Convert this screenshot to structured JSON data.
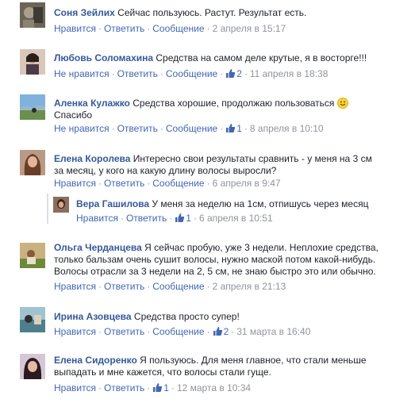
{
  "comments": [
    {
      "author": "Соня Зейлих",
      "text": "Сейчас пользуюсь. Растут. Результат есть.",
      "like_action": "Нравится",
      "reply_action": "Ответить",
      "message_action": "Сообщение",
      "likes": "",
      "time": "2 апреля в 15:17"
    },
    {
      "author": "Любовь Соломахина",
      "text": "Средства на самом деле крутые, я в восторге!!!",
      "like_action": "Не нравится",
      "reply_action": "Ответить",
      "message_action": "Сообщение",
      "likes": "2",
      "time": "11 апреля в 18:38"
    },
    {
      "author": "Аленка Кулажко",
      "text": "Средства хорошие, продолжаю пользоваться",
      "text_line2": "Спасибо",
      "emoji": "smile-emoji",
      "like_action": "Не нравится",
      "reply_action": "Ответить",
      "message_action": "Сообщение",
      "likes": "1",
      "time": "8 апреля в 10:10"
    },
    {
      "author": "Елена Королева",
      "text": "Интересно свои результаты сравнить - у меня на 3 см",
      "text_line2": "за месяц, у кого на какую длину волосы выросли?",
      "like_action": "Нравится",
      "reply_action": "Ответить",
      "message_action": "Сообщение",
      "likes": "",
      "time": "6 апреля в 9:47"
    },
    {
      "author": "Вера Гашилова",
      "text": "У меня за неделю на 1см, отпишусь через месяц",
      "like_action": "Нравится",
      "reply_action": "Ответить",
      "message_action": "",
      "likes": "1",
      "time": "6 апреля в 10:51"
    },
    {
      "author": "Ольга Черданцева",
      "text": "Я сейчас пробую, уже 3 недели. Неплохие средства,",
      "text_line2": "только бальзам очень сушит волосы, нужно маской потом какой-нибудь.",
      "text_line3": "Волосы отрасли за 3 недели на 2, 5 см, не знаю быстро это или обычно.",
      "like_action": "Нравится",
      "reply_action": "Ответить",
      "message_action": "Сообщение",
      "likes": "",
      "time": "2 апреля в 21:13"
    },
    {
      "author": "Ирина Азовцева",
      "text": "Средства просто супер!",
      "like_action": "Нравится",
      "reply_action": "Ответить",
      "message_action": "Сообщение",
      "likes": "2",
      "time": "31 марта в 16:40"
    },
    {
      "author": "Елена Сидоренко",
      "text": "Я пользуюсь. Для меня главное, что стали меньше",
      "text_line2": "выпадать и мне кажется, что волосы стали гуще.",
      "like_action": "Нравится",
      "reply_action": "Ответить",
      "message_action": "",
      "likes": "1",
      "time": "12 марта в 10:34"
    }
  ],
  "colors": {
    "name": "#365899",
    "link": "#4267b2",
    "muted": "#90949c"
  },
  "icons": {
    "like": "thumbs-up-icon"
  }
}
